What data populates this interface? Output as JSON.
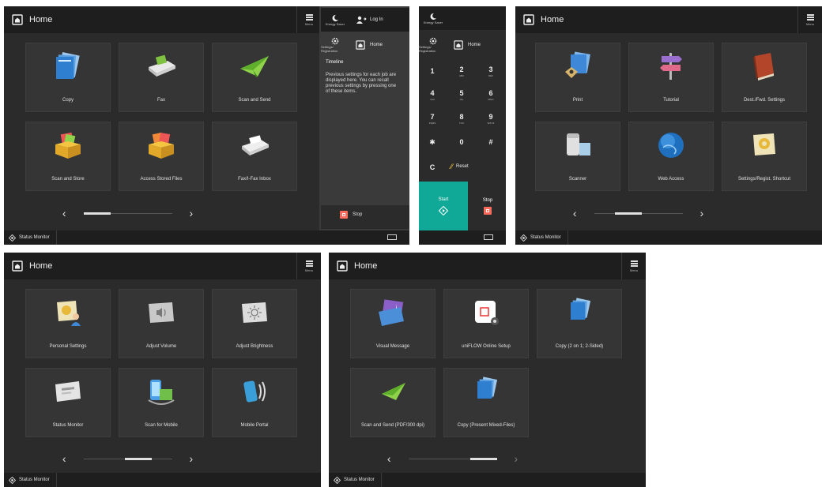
{
  "common": {
    "home_label": "Home",
    "menu_label": "Menu",
    "status_monitor": "Status Monitor"
  },
  "screen1": {
    "tiles": [
      {
        "label": "Copy",
        "icon": "copy-icon"
      },
      {
        "label": "Fax",
        "icon": "fax-icon"
      },
      {
        "label": "Scan and Send",
        "icon": "scan-send-icon"
      },
      {
        "label": "Scan and Store",
        "icon": "scan-store-icon"
      },
      {
        "label": "Access Stored Files",
        "icon": "stored-files-icon"
      },
      {
        "label": "Fax/I-Fax Inbox",
        "icon": "fax-inbox-icon"
      }
    ],
    "side": {
      "energy_saver": "Energy Saver",
      "log_in": "Log In",
      "settings_registration": "Settings/ Registration",
      "home": "Home",
      "timeline_title": "Timeline",
      "timeline_text": "Previous settings for each job are displayed here. You can recall previous settings by pressing one of these items.",
      "stop": "Stop"
    }
  },
  "keypad": {
    "energy_saver": "Energy Saver",
    "settings_registration": "Settings/ Registration",
    "home": "Home",
    "keys": [
      {
        "main": "1",
        "sub": ""
      },
      {
        "main": "2",
        "sub": "ABC"
      },
      {
        "main": "3",
        "sub": "DEF"
      },
      {
        "main": "4",
        "sub": "GHI"
      },
      {
        "main": "5",
        "sub": "JKL"
      },
      {
        "main": "6",
        "sub": "MNO"
      },
      {
        "main": "7",
        "sub": "PQRS"
      },
      {
        "main": "8",
        "sub": "TUV"
      },
      {
        "main": "9",
        "sub": "WXYZ"
      },
      {
        "main": "✱",
        "sub": ""
      },
      {
        "main": "0",
        "sub": ""
      },
      {
        "main": "#",
        "sub": ""
      }
    ],
    "clear": "C",
    "reset": "Reset",
    "start": "Start",
    "stop": "Stop"
  },
  "screen2": {
    "tiles": [
      {
        "label": "Print",
        "icon": "print-icon"
      },
      {
        "label": "Tutorial",
        "icon": "tutorial-signpost-icon"
      },
      {
        "label": "Dest./Fwd. Settings",
        "icon": "address-book-icon"
      },
      {
        "label": "Scanner",
        "icon": "scanner-icon"
      },
      {
        "label": "Web Access",
        "icon": "globe-icon"
      },
      {
        "label": "Settings/Regist. Shortcut",
        "icon": "settings-shortcut-icon"
      }
    ]
  },
  "screen3": {
    "tiles": [
      {
        "label": "Personal Settings",
        "icon": "personal-settings-icon"
      },
      {
        "label": "Adjust Volume",
        "icon": "volume-icon"
      },
      {
        "label": "Adjust Brightness",
        "icon": "brightness-icon"
      },
      {
        "label": "Status Monitor",
        "icon": "status-monitor-icon"
      },
      {
        "label": "Scan for Mobile",
        "icon": "scan-mobile-icon"
      },
      {
        "label": "Mobile Portal",
        "icon": "mobile-portal-icon"
      }
    ]
  },
  "screen4": {
    "tiles": [
      {
        "label": "Visual Message",
        "icon": "visual-message-icon"
      },
      {
        "label": "uniFLOW Online Setup",
        "icon": "uniflow-setup-icon"
      },
      {
        "label": "Copy (2 on 1; 2-Sided)",
        "icon": "copy-icon"
      },
      {
        "label": "Scan and Send (PDF/300 dpi)",
        "icon": "scan-send-icon"
      },
      {
        "label": "Copy (Present Mixed-Files)",
        "icon": "copy-icon"
      }
    ]
  },
  "colors": {
    "panel_bg": "#2b2b2b",
    "bar_bg": "#1e1e1e",
    "tile_bg": "#353535",
    "start_green": "#10a896",
    "stop_red": "#ff6a5a"
  }
}
